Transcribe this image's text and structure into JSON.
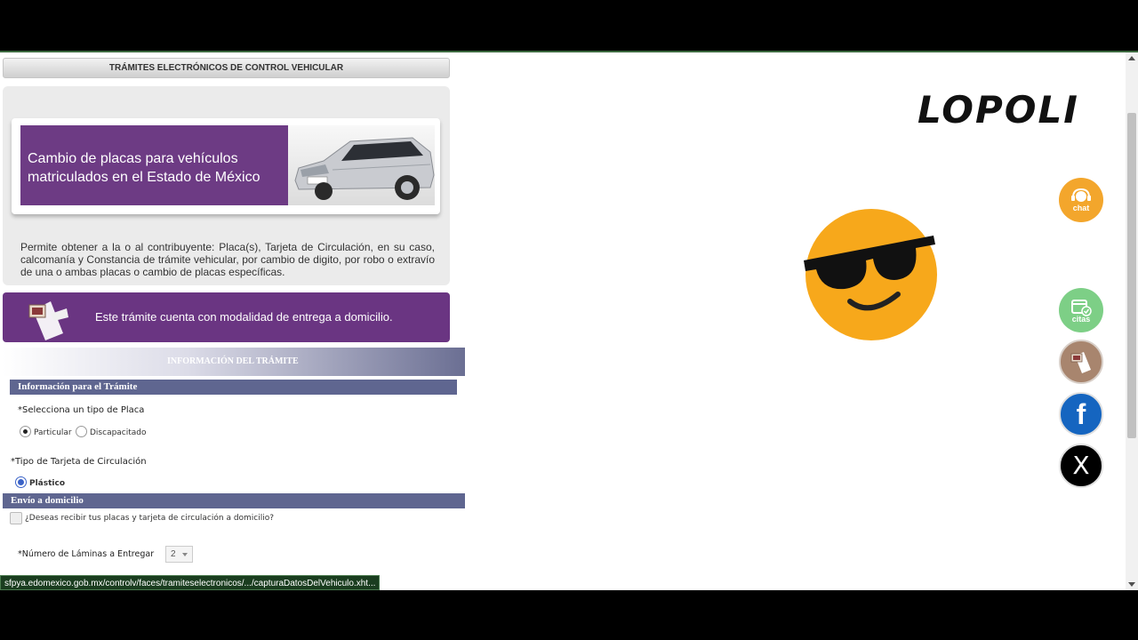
{
  "header": {
    "title": "TRÁMITES ELECTRÓNICOS DE CONTROL VEHICULAR"
  },
  "banner": {
    "line1": "Cambio de placas para vehículos",
    "line2": "matriculados en el Estado de México"
  },
  "description": "Permite obtener a la o al contribuyente: Placa(s), Tarjeta de Circulación, en su caso, calcomanía y Constancia de trámite vehicular, por cambio de digito, por robo o extravío de una o ambas placas o cambio de placas específicas.",
  "delivery_banner": {
    "text": "Este trámite cuenta con modalidad de entrega a domicilio."
  },
  "info_section": {
    "title": "INFORMACIÓN DEL TRÁMITE",
    "subheader": "Información para el Trámite"
  },
  "plate_type": {
    "label": "*Selecciona un tipo de Placa",
    "options": [
      {
        "label": "Particular",
        "selected": true
      },
      {
        "label": "Discapacitado",
        "selected": false
      }
    ]
  },
  "card_type": {
    "label": "*Tipo de Tarjeta de Circulación",
    "options": [
      {
        "label": "Plástico",
        "selected": true
      }
    ]
  },
  "home_delivery": {
    "header": "Envío a domicilio",
    "checkbox_label": "¿Deseas recibir tus placas y tarjeta de circulación a domicilio?",
    "checked": false
  },
  "sheets": {
    "label": "*Número de Láminas a Entregar",
    "value": "2"
  },
  "status_url": "sfpya.edomexico.gob.mx/controlv/faces/tramiteselectronicos/.../capturaDatosDelVehiculo.xht...",
  "overlay": {
    "logo": "LOPOLI"
  },
  "side_buttons": [
    {
      "label": "chat",
      "color": "#f3a62c"
    },
    {
      "label": "citas",
      "color": "#7dcf86"
    },
    {
      "label": "",
      "color": "#a8856e"
    },
    {
      "label": "f",
      "color": "#1565c0"
    },
    {
      "label": "X",
      "color": "#000000"
    }
  ],
  "colors": {
    "purple": "#6a3582",
    "section": "#5f6690",
    "accent_green": "#3c6a3f"
  }
}
